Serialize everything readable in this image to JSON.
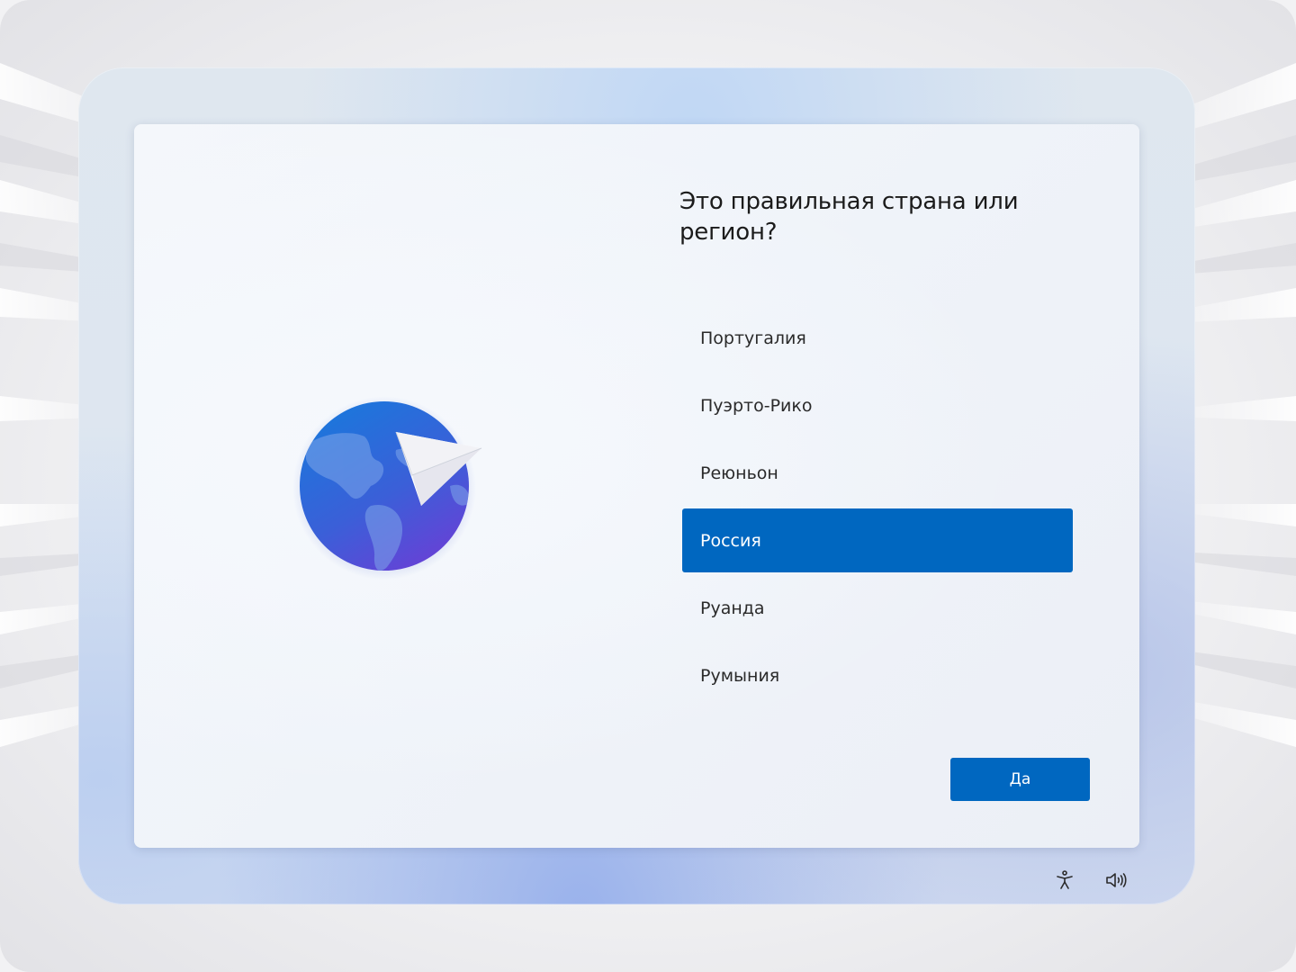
{
  "dialog": {
    "title": "Это правильная страна или регион?",
    "illustration": "globe-paper-plane-icon",
    "countries": [
      {
        "label": "Португалия",
        "selected": false
      },
      {
        "label": "Пуэрто-Рико",
        "selected": false
      },
      {
        "label": "Реюньон",
        "selected": false
      },
      {
        "label": "Россия",
        "selected": true
      },
      {
        "label": "Руанда",
        "selected": false
      },
      {
        "label": "Румыния",
        "selected": false
      }
    ],
    "confirm_label": "Да"
  },
  "tray": {
    "accessibility_icon": "accessibility-icon",
    "volume_icon": "volume-icon"
  },
  "colors": {
    "accent": "#0067c0",
    "text": "#1b1b1b",
    "card": "#f2f5fa"
  }
}
